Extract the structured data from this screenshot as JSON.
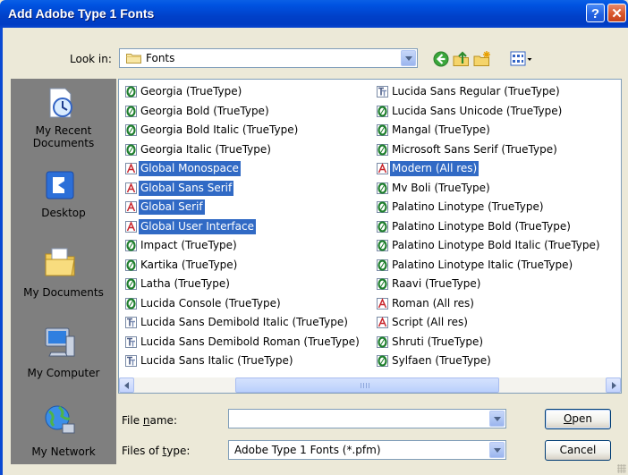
{
  "window": {
    "title": "Add Adobe Type 1 Fonts",
    "help_glyph": "?",
    "close_glyph": "✕"
  },
  "lookin": {
    "label": "Look in:",
    "value": "Fonts"
  },
  "toolbar": [
    "back-icon",
    "up-folder-icon",
    "new-folder-icon",
    "views-menu-icon"
  ],
  "places": [
    {
      "label": "My Recent Documents",
      "icon": "recent-documents-icon"
    },
    {
      "label": "Desktop",
      "icon": "desktop-icon"
    },
    {
      "label": "My Documents",
      "icon": "my-documents-icon"
    },
    {
      "label": "My Computer",
      "icon": "my-computer-icon"
    },
    {
      "label": "My Network",
      "icon": "my-network-icon"
    }
  ],
  "files": {
    "col1": [
      {
        "name": "Georgia (TrueType)",
        "type": "opentype",
        "selected": false
      },
      {
        "name": "Georgia Bold (TrueType)",
        "type": "opentype",
        "selected": false
      },
      {
        "name": "Georgia Bold Italic (TrueType)",
        "type": "opentype",
        "selected": false
      },
      {
        "name": "Georgia Italic (TrueType)",
        "type": "opentype",
        "selected": false
      },
      {
        "name": "Global Monospace",
        "type": "raster",
        "selected": true
      },
      {
        "name": "Global Sans Serif",
        "type": "raster",
        "selected": true
      },
      {
        "name": "Global Serif",
        "type": "raster",
        "selected": true
      },
      {
        "name": "Global User Interface",
        "type": "raster",
        "selected": true
      },
      {
        "name": "Impact (TrueType)",
        "type": "opentype",
        "selected": false
      },
      {
        "name": "Kartika (TrueType)",
        "type": "opentype",
        "selected": false
      },
      {
        "name": "Latha (TrueType)",
        "type": "opentype",
        "selected": false
      },
      {
        "name": "Lucida Console (TrueType)",
        "type": "opentype",
        "selected": false
      },
      {
        "name": "Lucida Sans Demibold Italic (TrueType)",
        "type": "truetype",
        "selected": false
      },
      {
        "name": "Lucida Sans Demibold Roman (TrueType)",
        "type": "truetype",
        "selected": false
      },
      {
        "name": "Lucida Sans Italic (TrueType)",
        "type": "truetype",
        "selected": false
      }
    ],
    "col2": [
      {
        "name": "Lucida Sans Regular (TrueType)",
        "type": "truetype",
        "selected": false
      },
      {
        "name": "Lucida Sans Unicode (TrueType)",
        "type": "opentype",
        "selected": false
      },
      {
        "name": "Mangal (TrueType)",
        "type": "opentype",
        "selected": false
      },
      {
        "name": "Microsoft Sans Serif (TrueType)",
        "type": "opentype",
        "selected": false
      },
      {
        "name": "Modern (All res)",
        "type": "raster",
        "selected": true
      },
      {
        "name": "Mv Boli (TrueType)",
        "type": "opentype",
        "selected": false
      },
      {
        "name": "Palatino Linotype (TrueType)",
        "type": "opentype",
        "selected": false
      },
      {
        "name": "Palatino Linotype Bold (TrueType)",
        "type": "opentype",
        "selected": false
      },
      {
        "name": "Palatino Linotype Bold Italic (TrueType)",
        "type": "opentype",
        "selected": false
      },
      {
        "name": "Palatino Linotype Italic (TrueType)",
        "type": "opentype",
        "selected": false
      },
      {
        "name": "Raavi (TrueType)",
        "type": "opentype",
        "selected": false
      },
      {
        "name": "Roman (All res)",
        "type": "raster",
        "selected": false
      },
      {
        "name": "Script (All res)",
        "type": "raster",
        "selected": false
      },
      {
        "name": "Shruti (TrueType)",
        "type": "opentype",
        "selected": false
      },
      {
        "name": "Sylfaen (TrueType)",
        "type": "opentype",
        "selected": false
      }
    ]
  },
  "filename": {
    "label_pre": "File ",
    "label_u": "n",
    "label_post": "ame:",
    "value": ""
  },
  "filetype": {
    "label_pre": "Files of ",
    "label_u": "t",
    "label_post": "ype:",
    "value": "Adobe Type 1 Fonts (*.pfm)"
  },
  "buttons": {
    "open_u": "O",
    "open_rest": "pen",
    "cancel": "Cancel"
  },
  "colors": {
    "selection": "#316AC5",
    "titlebar": "#0040C8",
    "dialog_bg": "#ECE9D8",
    "places_bg": "#7F7F7F"
  }
}
